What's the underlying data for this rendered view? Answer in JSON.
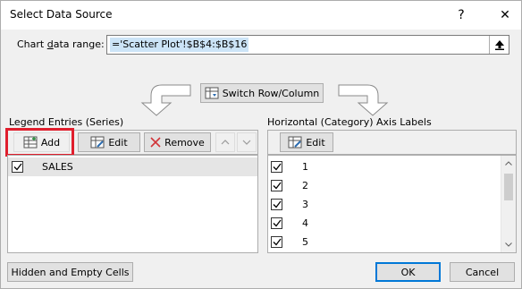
{
  "window": {
    "title": "Select Data Source",
    "help_glyph": "?",
    "close_glyph": "✕"
  },
  "range": {
    "label": "Chart data range:",
    "value": "='Scatter Plot'!$B$4:$B$16"
  },
  "switch_button": {
    "label": "Switch Row/Column"
  },
  "legend": {
    "header": "Legend Entries (Series)",
    "add_label": "Add",
    "edit_label": "Edit",
    "remove_label": "Remove",
    "items": [
      {
        "label": "SALES",
        "checked": true
      }
    ]
  },
  "axis": {
    "header": "Horizontal (Category) Axis Labels",
    "edit_label": "Edit",
    "items": [
      {
        "label": "1",
        "checked": true
      },
      {
        "label": "2",
        "checked": true
      },
      {
        "label": "3",
        "checked": true
      },
      {
        "label": "4",
        "checked": true
      },
      {
        "label": "5",
        "checked": true
      }
    ]
  },
  "footer": {
    "hidden_cells_label": "Hidden and Empty Cells",
    "ok_label": "OK",
    "cancel_label": "Cancel"
  },
  "colors": {
    "highlight": "#e01e2d",
    "selection": "#cce4f7",
    "primary_border": "#0078d7"
  },
  "icons": {
    "add": "add-table-icon",
    "edit": "edit-table-icon",
    "remove": "remove-x-icon",
    "switch": "switch-row-column-icon",
    "collapse": "collapse-arrow-up-icon"
  }
}
